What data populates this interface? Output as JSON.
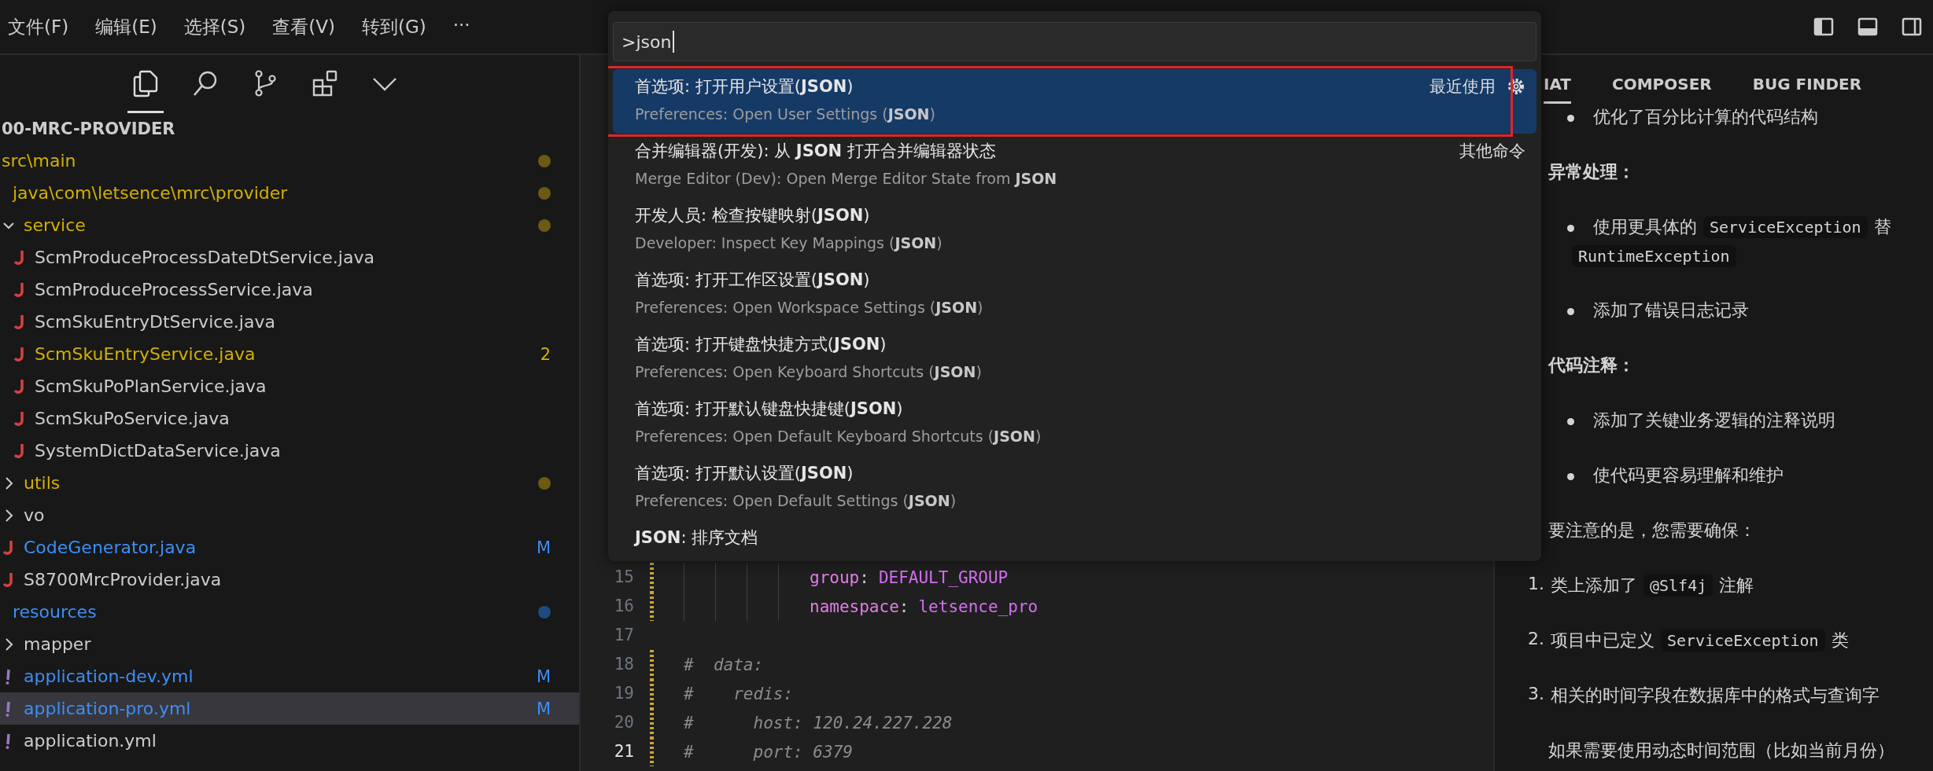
{
  "menu": [
    "文件(F)",
    "编辑(E)",
    "选择(S)",
    "查看(V)",
    "转到(G)",
    "···"
  ],
  "activity": [
    {
      "kind": "files",
      "selected": true
    },
    {
      "kind": "search",
      "selected": false
    },
    {
      "kind": "git",
      "selected": false
    },
    {
      "kind": "extensions",
      "selected": false
    },
    {
      "kind": "more",
      "selected": false
    }
  ],
  "explorer": {
    "title": "00-MRC-PROVIDER",
    "tree": [
      {
        "kind": "folder",
        "label": "src\\main",
        "warning": true,
        "selected": false,
        "children": [
          {
            "kind": "folder",
            "label": "java\\com\\letsence\\mrc\\provider",
            "warning": true,
            "selected": false,
            "children": [
              {
                "kind": "folder",
                "label": "service",
                "expanded": true,
                "warning": true,
                "selected": false,
                "children": [
                  {
                    "kind": "java",
                    "label": "ScmProduceProcessDateDtService.java",
                    "warning": false,
                    "modified": false,
                    "selected": false
                  },
                  {
                    "kind": "java",
                    "label": "ScmProduceProcessService.java",
                    "warning": false,
                    "modified": false,
                    "selected": false
                  },
                  {
                    "kind": "java",
                    "label": "ScmSkuEntryDtService.java",
                    "warning": false,
                    "modified": false,
                    "selected": false
                  },
                  {
                    "kind": "java",
                    "label": "ScmSkuEntryService.java",
                    "warning": true,
                    "badge": "2",
                    "selected": false
                  },
                  {
                    "kind": "java",
                    "label": "ScmSkuPoPlanService.java",
                    "warning": false,
                    "modified": false,
                    "selected": false
                  },
                  {
                    "kind": "java",
                    "label": "ScmSkuPoService.java",
                    "warning": false,
                    "modified": false,
                    "selected": false
                  },
                  {
                    "kind": "java",
                    "label": "SystemDictDataService.java",
                    "warning": false,
                    "modified": false,
                    "selected": false
                  }
                ]
              },
              {
                "kind": "folder",
                "label": "utils",
                "expanded": false,
                "warning": true,
                "selected": false
              },
              {
                "kind": "folder",
                "label": "vo",
                "expanded": false,
                "warning": false,
                "modified": false,
                "selected": false
              },
              {
                "kind": "java",
                "label": "CodeGenerator.java",
                "warning": false,
                "modified": true,
                "badge": "M",
                "selected": false
              },
              {
                "kind": "java",
                "label": "S8700MrcProvider.java",
                "warning": false,
                "modified": false,
                "selected": false
              }
            ]
          },
          {
            "kind": "folder",
            "label": "resources",
            "warning": false,
            "modified": true,
            "selected": false,
            "children": [
              {
                "kind": "folder",
                "label": "mapper",
                "expanded": false,
                "warning": false,
                "modified": false,
                "selected": false
              },
              {
                "kind": "yaml",
                "label": "application-dev.yml",
                "warning": false,
                "modified": true,
                "badge": "M",
                "selected": false
              },
              {
                "kind": "yaml",
                "label": "application-pro.yml",
                "warning": false,
                "modified": true,
                "badge": "M",
                "selected": true
              },
              {
                "kind": "yaml",
                "label": "application.yml",
                "warning": false,
                "modified": false,
                "selected": false
              }
            ]
          }
        ]
      }
    ]
  },
  "palette": {
    "value": ">json",
    "items": [
      {
        "title": "首选项: 打开用户设置(**JSON**)",
        "subtitle": "Preferences: Open User Settings (**JSON**)",
        "tag": "最近使用",
        "gear": true,
        "selected": true,
        "annotated": true
      },
      {
        "title": "合并编辑器(开发): 从 **JSON** 打开合并编辑器状态",
        "subtitle": "Merge Editor (Dev): Open Merge Editor State from **JSON**",
        "tag": "其他命令",
        "gear": false,
        "selected": false,
        "annotated": false
      },
      {
        "title": "开发人员: 检查按键映射(**JSON**)",
        "subtitle": "Developer: Inspect Key Mappings (**JSON**)",
        "gear": false,
        "selected": false,
        "annotated": false
      },
      {
        "title": "首选项: 打开工作区设置(**JSON**)",
        "subtitle": "Preferences: Open Workspace Settings (**JSON**)",
        "gear": false,
        "selected": false,
        "annotated": false
      },
      {
        "title": "首选项: 打开键盘快捷方式(**JSON**)",
        "subtitle": "Preferences: Open Keyboard Shortcuts (**JSON**)",
        "gear": false,
        "selected": false,
        "annotated": false
      },
      {
        "title": "首选项: 打开默认键盘快捷键(**JSON**)",
        "subtitle": "Preferences: Open Default Keyboard Shortcuts (**JSON**)",
        "gear": false,
        "selected": false,
        "annotated": false
      },
      {
        "title": "首选项: 打开默认设置(**JSON**)",
        "subtitle": "Preferences: Open Default Settings (**JSON**)",
        "gear": false,
        "selected": false,
        "annotated": false
      },
      {
        "title": "**JSON**: 排序文档",
        "gear": false,
        "selected": false,
        "annotated": false
      }
    ]
  },
  "editor": {
    "lines": [
      {
        "number": "15",
        "kind": "pair",
        "key": "group",
        "colon": ":",
        "value": "DEFAULT_GROUP",
        "indented": true,
        "changed": true,
        "current": false
      },
      {
        "number": "16",
        "kind": "pair",
        "key": "namespace",
        "colon": ":",
        "value": "letsence_pro",
        "indented": true,
        "changed": true,
        "current": false
      },
      {
        "number": "17",
        "kind": "blank",
        "indented": false,
        "changed": false,
        "current": false
      },
      {
        "number": "18",
        "kind": "comment",
        "text": "#  data:",
        "indented": false,
        "changed": true,
        "current": false
      },
      {
        "number": "19",
        "kind": "comment",
        "text": "#    redis:",
        "indented": false,
        "changed": true,
        "current": false
      },
      {
        "number": "20",
        "kind": "comment",
        "text": "#      host: 120.24.227.228",
        "indented": false,
        "changed": true,
        "current": false
      },
      {
        "number": "21",
        "kind": "comment",
        "text": "#      port: 6379",
        "indented": false,
        "changed": true,
        "current": true
      }
    ]
  },
  "chat": {
    "tabs": [
      {
        "label": "IAT",
        "selected": true
      },
      {
        "label": "COMPOSER",
        "selected": false
      },
      {
        "label": "BUG FINDER",
        "selected": false
      }
    ],
    "blocks": [
      {
        "kind": "bullet",
        "lines": [
          [
            {
              "kind": "text",
              "text": "优化了百分比计算的代码结构"
            }
          ]
        ]
      },
      {
        "kind": "heading",
        "lines": [
          [
            {
              "kind": "text",
              "text": "异常处理："
            }
          ]
        ]
      },
      {
        "kind": "bullet",
        "lines": [
          [
            {
              "kind": "text",
              "text": "使用更具体的"
            },
            {
              "kind": "code",
              "text": "ServiceException"
            },
            {
              "kind": "text",
              "text": "替"
            }
          ],
          [
            {
              "kind": "code",
              "text": "RuntimeException"
            }
          ]
        ]
      },
      {
        "kind": "bullet",
        "lines": [
          [
            {
              "kind": "text",
              "text": "添加了错误日志记录"
            }
          ]
        ]
      },
      {
        "kind": "heading",
        "lines": [
          [
            {
              "kind": "text",
              "text": "代码注释："
            }
          ]
        ]
      },
      {
        "kind": "bullet",
        "lines": [
          [
            {
              "kind": "text",
              "text": "添加了关键业务逻辑的注释说明"
            }
          ]
        ]
      },
      {
        "kind": "bullet",
        "lines": [
          [
            {
              "kind": "text",
              "text": "使代码更容易理解和维护"
            }
          ]
        ]
      },
      {
        "kind": "paragraph",
        "lines": [
          [
            {
              "kind": "text",
              "text": "要注意的是，您需要确保："
            }
          ]
        ]
      },
      {
        "kind": "numbered",
        "number": "1.",
        "lines": [
          [
            {
              "kind": "text",
              "text": "类上添加了"
            },
            {
              "kind": "code",
              "text": "@Slf4j"
            },
            {
              "kind": "text",
              "text": "注解"
            }
          ]
        ]
      },
      {
        "kind": "numbered",
        "number": "2.",
        "lines": [
          [
            {
              "kind": "text",
              "text": "项目中已定义"
            },
            {
              "kind": "code",
              "text": "ServiceException"
            },
            {
              "kind": "text",
              "text": "类"
            }
          ]
        ]
      },
      {
        "kind": "numbered",
        "number": "3.",
        "lines": [
          [
            {
              "kind": "text",
              "text": "相关的时间字段在数据库中的格式与查询字"
            }
          ]
        ]
      },
      {
        "kind": "paragraph",
        "lines": [
          [
            {
              "kind": "text",
              "text": "如果需要使用动态时间范围（比如当前月份）"
            }
          ]
        ]
      }
    ]
  }
}
